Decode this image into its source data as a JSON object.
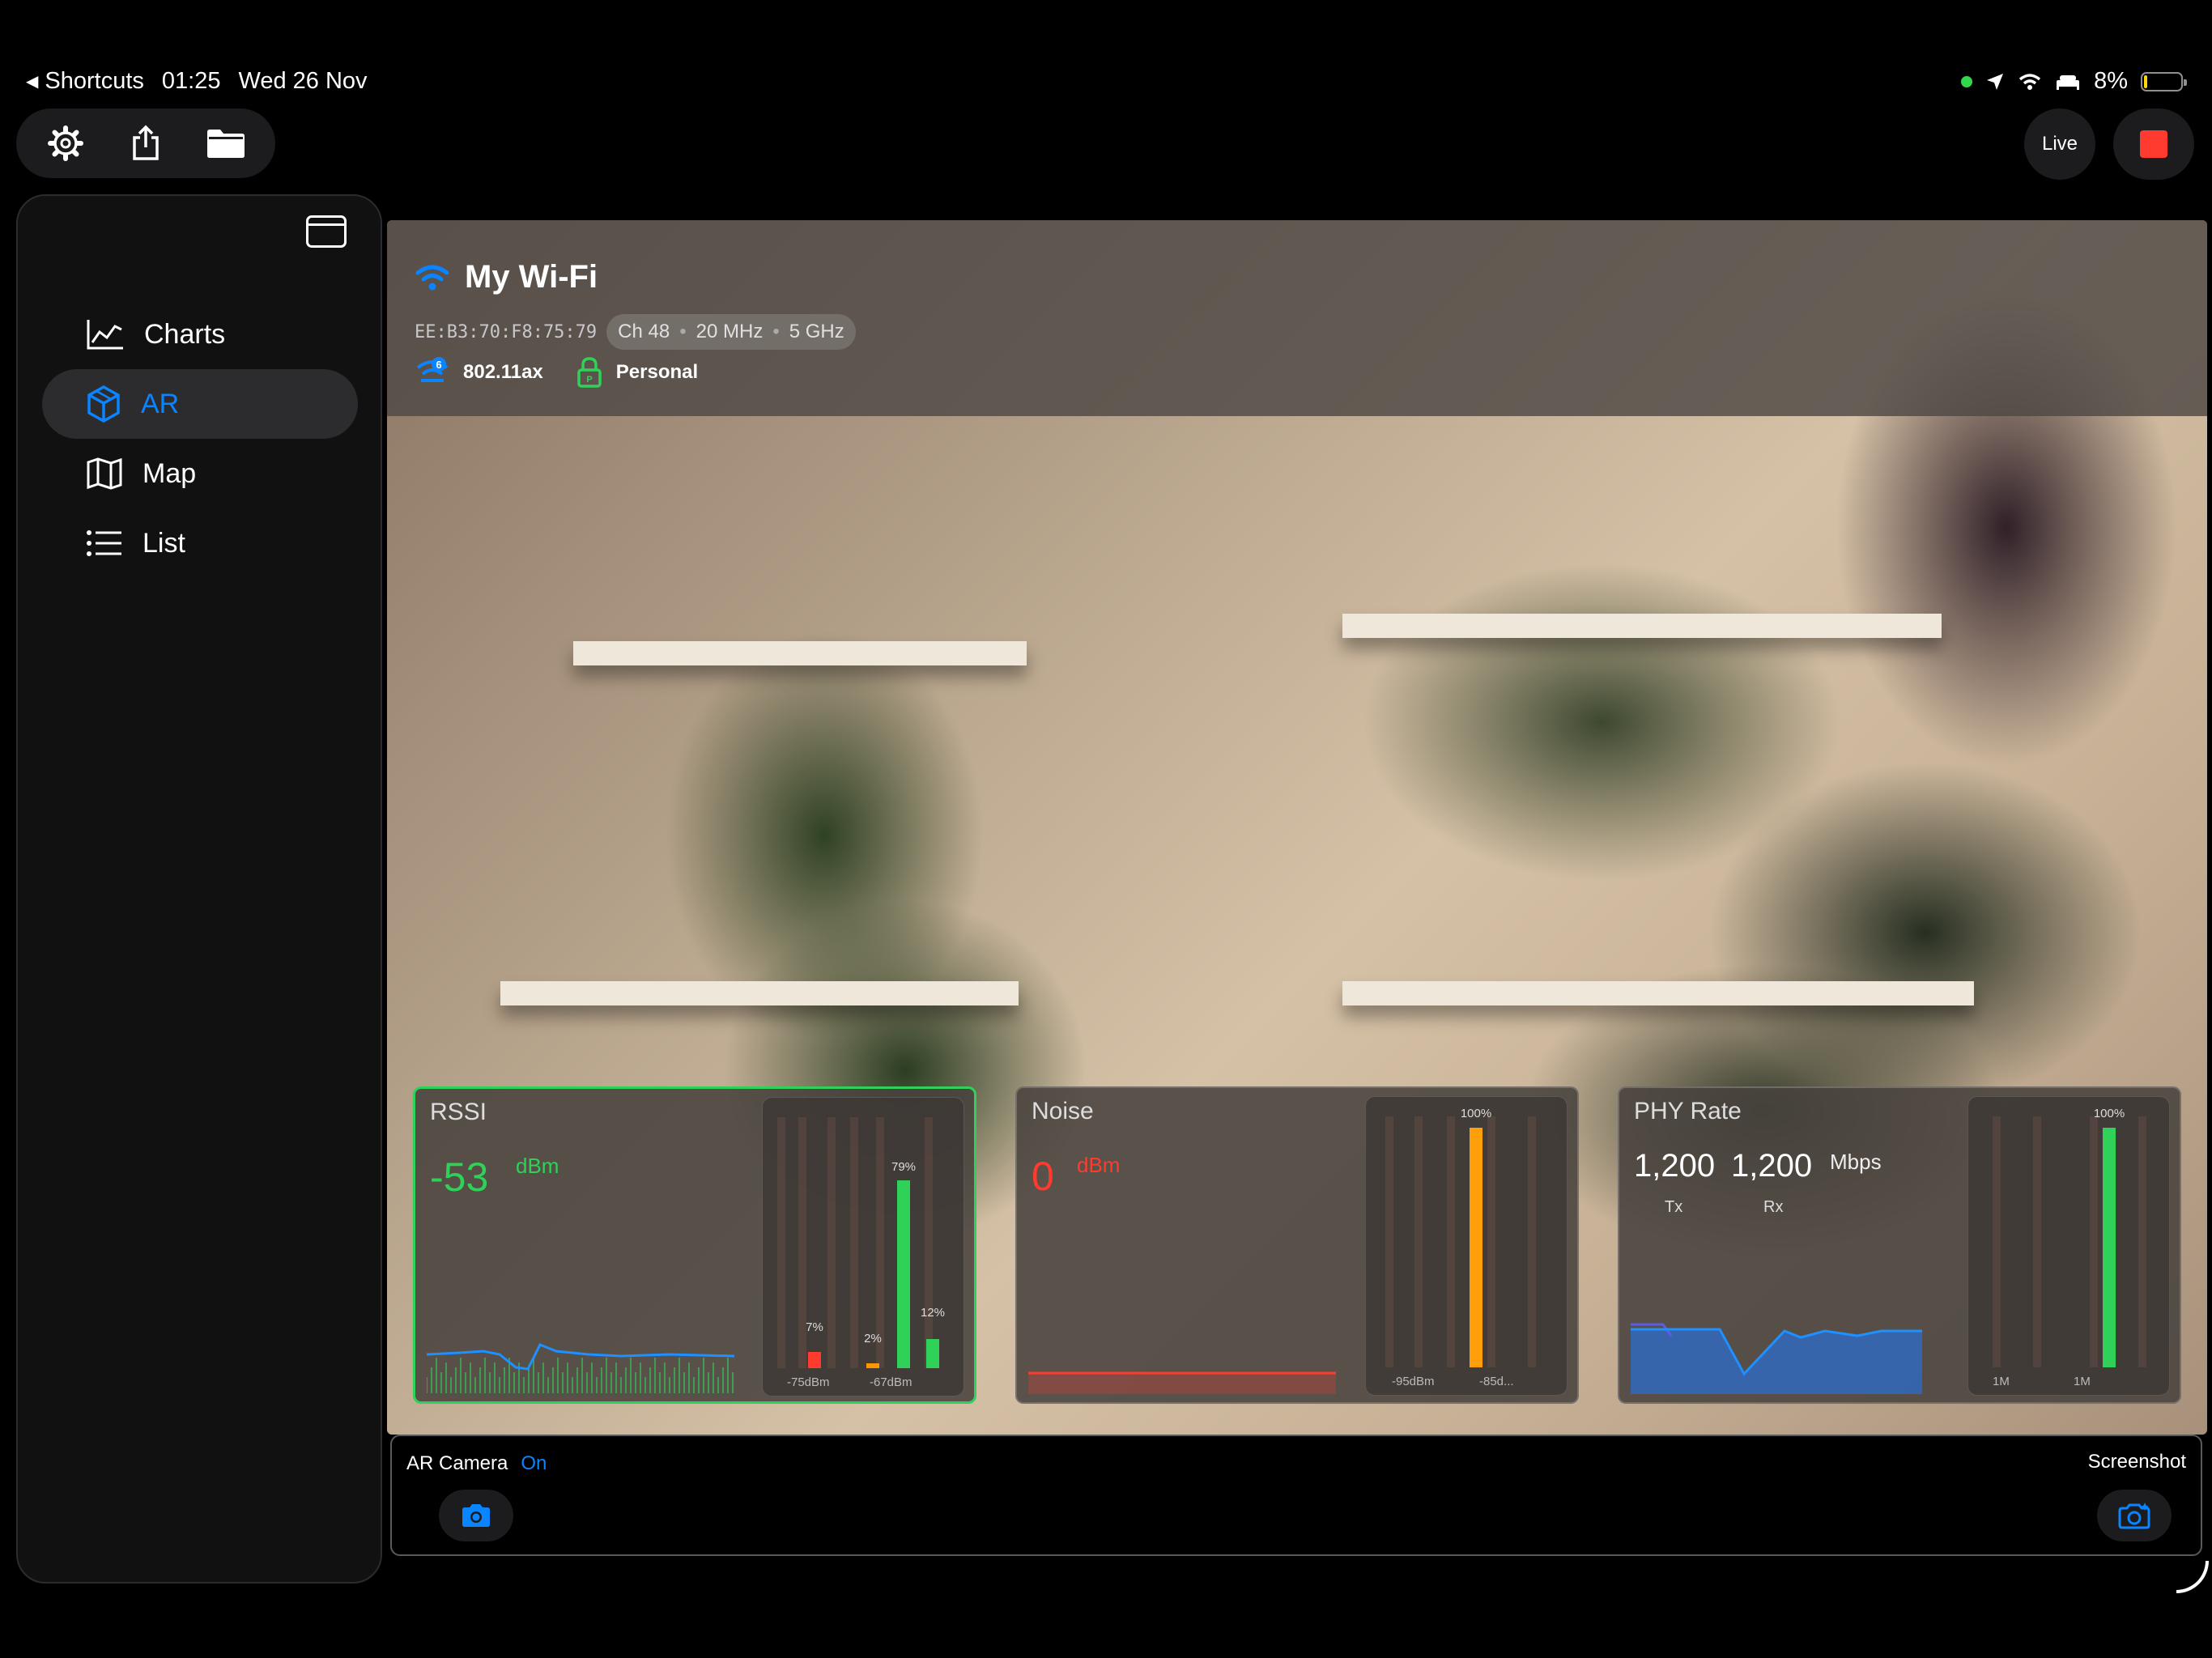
{
  "status_bar": {
    "back_app": "Shortcuts",
    "time": "01:25",
    "date": "Wed 26 Nov",
    "battery": "8%"
  },
  "top_right": {
    "live_label": "Live"
  },
  "sidebar": {
    "items": [
      {
        "label": "Charts",
        "icon": "chart-icon",
        "active": false
      },
      {
        "label": "AR",
        "icon": "ar-cube-icon",
        "active": true
      },
      {
        "label": "Map",
        "icon": "map-icon",
        "active": false
      },
      {
        "label": "List",
        "icon": "list-icon",
        "active": false
      }
    ]
  },
  "network": {
    "ssid": "My Wi-Fi",
    "bssid": "EE:B3:70:F8:75:79",
    "channel": "Ch 48",
    "width": "20 MHz",
    "band": "5 GHz",
    "standard": "802.11ax",
    "security": "Personal"
  },
  "cards": {
    "rssi": {
      "title": "RSSI",
      "value": "-53",
      "unit": "dBm",
      "bars": [
        {
          "pct": "7%",
          "fraction": 0.07,
          "color": "#ff3b30"
        },
        {
          "pct": "2%",
          "fraction": 0.02,
          "color": "#ff9500"
        },
        {
          "pct": "79%",
          "fraction": 0.79,
          "color": "#30d158"
        },
        {
          "pct": "12%",
          "fraction": 0.12,
          "color": "#30d158"
        }
      ],
      "axis": [
        "-75dBm",
        "-67dBm"
      ]
    },
    "noise": {
      "title": "Noise",
      "value": "0",
      "unit": "dBm",
      "bars": [
        {
          "pct": "100%",
          "fraction": 1.0,
          "color": "#ff9f0a"
        }
      ],
      "axis": [
        "-95dBm",
        "-85d..."
      ]
    },
    "phy": {
      "title": "PHY Rate",
      "tx": "1,200",
      "rx": "1,200",
      "unit": "Mbps",
      "tx_label": "Tx",
      "rx_label": "Rx",
      "bars": [
        {
          "pct": "100%",
          "fraction": 1.0,
          "color": "#30d158"
        }
      ],
      "axis": [
        "1M",
        "1M"
      ]
    }
  },
  "controls": {
    "ar_camera_label": "AR Camera",
    "ar_camera_state": "On",
    "screenshot_label": "Screenshot"
  },
  "colors": {
    "accent": "#0a84ff",
    "good": "#30d158",
    "bad": "#ff3b30",
    "warn": "#ff9500"
  }
}
